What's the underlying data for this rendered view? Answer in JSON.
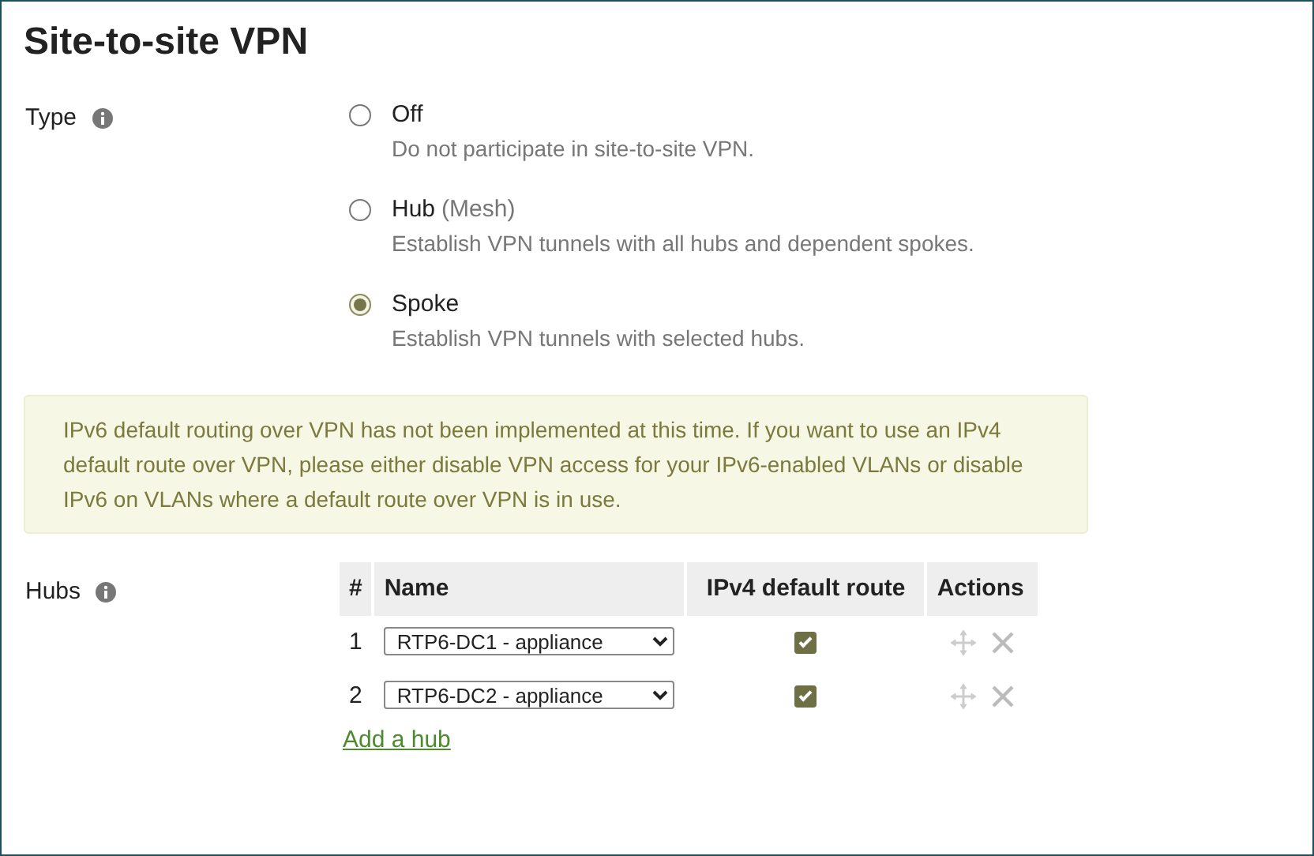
{
  "title": "Site-to-site VPN",
  "type": {
    "label": "Type",
    "options": [
      {
        "label": "Off",
        "description": "Do not participate in site-to-site VPN.",
        "selected": false
      },
      {
        "label": "Hub",
        "suffix": "(Mesh)",
        "description": "Establish VPN tunnels with all hubs and dependent spokes.",
        "selected": false
      },
      {
        "label": "Spoke",
        "description": "Establish VPN tunnels with selected hubs.",
        "selected": true
      }
    ]
  },
  "notice": "IPv6 default routing over VPN has not been implemented at this time. If you want to use an IPv4 default route over VPN, please either disable VPN access for your IPv6-enabled VLANs or disable IPv6 on VLANs where a default route over VPN is in use.",
  "hubs": {
    "label": "Hubs",
    "columns": [
      "#",
      "Name",
      "IPv4 default route",
      "Actions"
    ],
    "rows": [
      {
        "index": "1",
        "name": "RTP6-DC1 - appliance",
        "default_route": true
      },
      {
        "index": "2",
        "name": "RTP6-DC2 - appliance",
        "default_route": true
      }
    ],
    "add_link": "Add a hub"
  }
}
